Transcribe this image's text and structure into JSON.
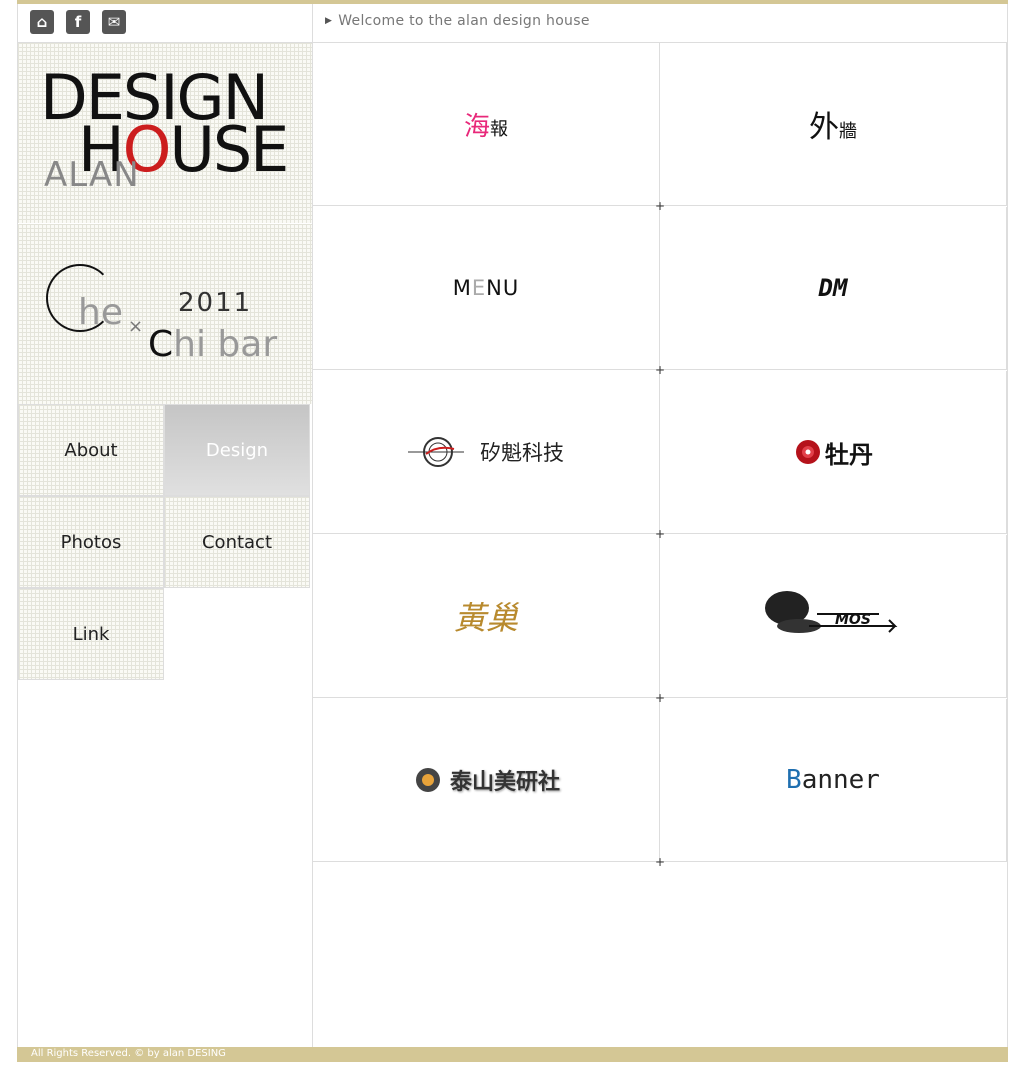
{
  "header": {
    "icons": [
      "home-icon",
      "facebook-icon",
      "mail-icon"
    ],
    "welcome": "Welcome  to the alan design house"
  },
  "logo": {
    "line1": "DESIGN",
    "line2_a": "H",
    "line2_o": "O",
    "line2_b": "USE",
    "line3": "ALAN"
  },
  "banner": {
    "he": "he",
    "x": "×",
    "year": "2011",
    "chi_c": "C",
    "chi_rest": "hi bar"
  },
  "nav": [
    {
      "label": "About"
    },
    {
      "label": "Design"
    },
    {
      "label": "Photos"
    },
    {
      "label": "Contact"
    },
    {
      "label": "Link"
    }
  ],
  "grid": [
    {
      "label_a": "海",
      "label_b": "報"
    },
    {
      "label_a": "外",
      "label_b": "牆"
    },
    {
      "label_a": "M",
      "label_b": "E",
      "label_c": "NU"
    },
    {
      "label": "DM"
    },
    {
      "label": "矽魁科技"
    },
    {
      "label": "牡丹"
    },
    {
      "label": "黃巢"
    },
    {
      "label": "MOS"
    },
    {
      "label": "泰山美研社"
    },
    {
      "label_a": "B",
      "label_b": "anner"
    }
  ],
  "footer": "All Rights Reserved. © by alan DESING",
  "colors": {
    "accent": "#d4c795",
    "red": "#cc1e1e",
    "banner_blue": "#1f6fb0",
    "poster_pink": "#e8287a"
  }
}
